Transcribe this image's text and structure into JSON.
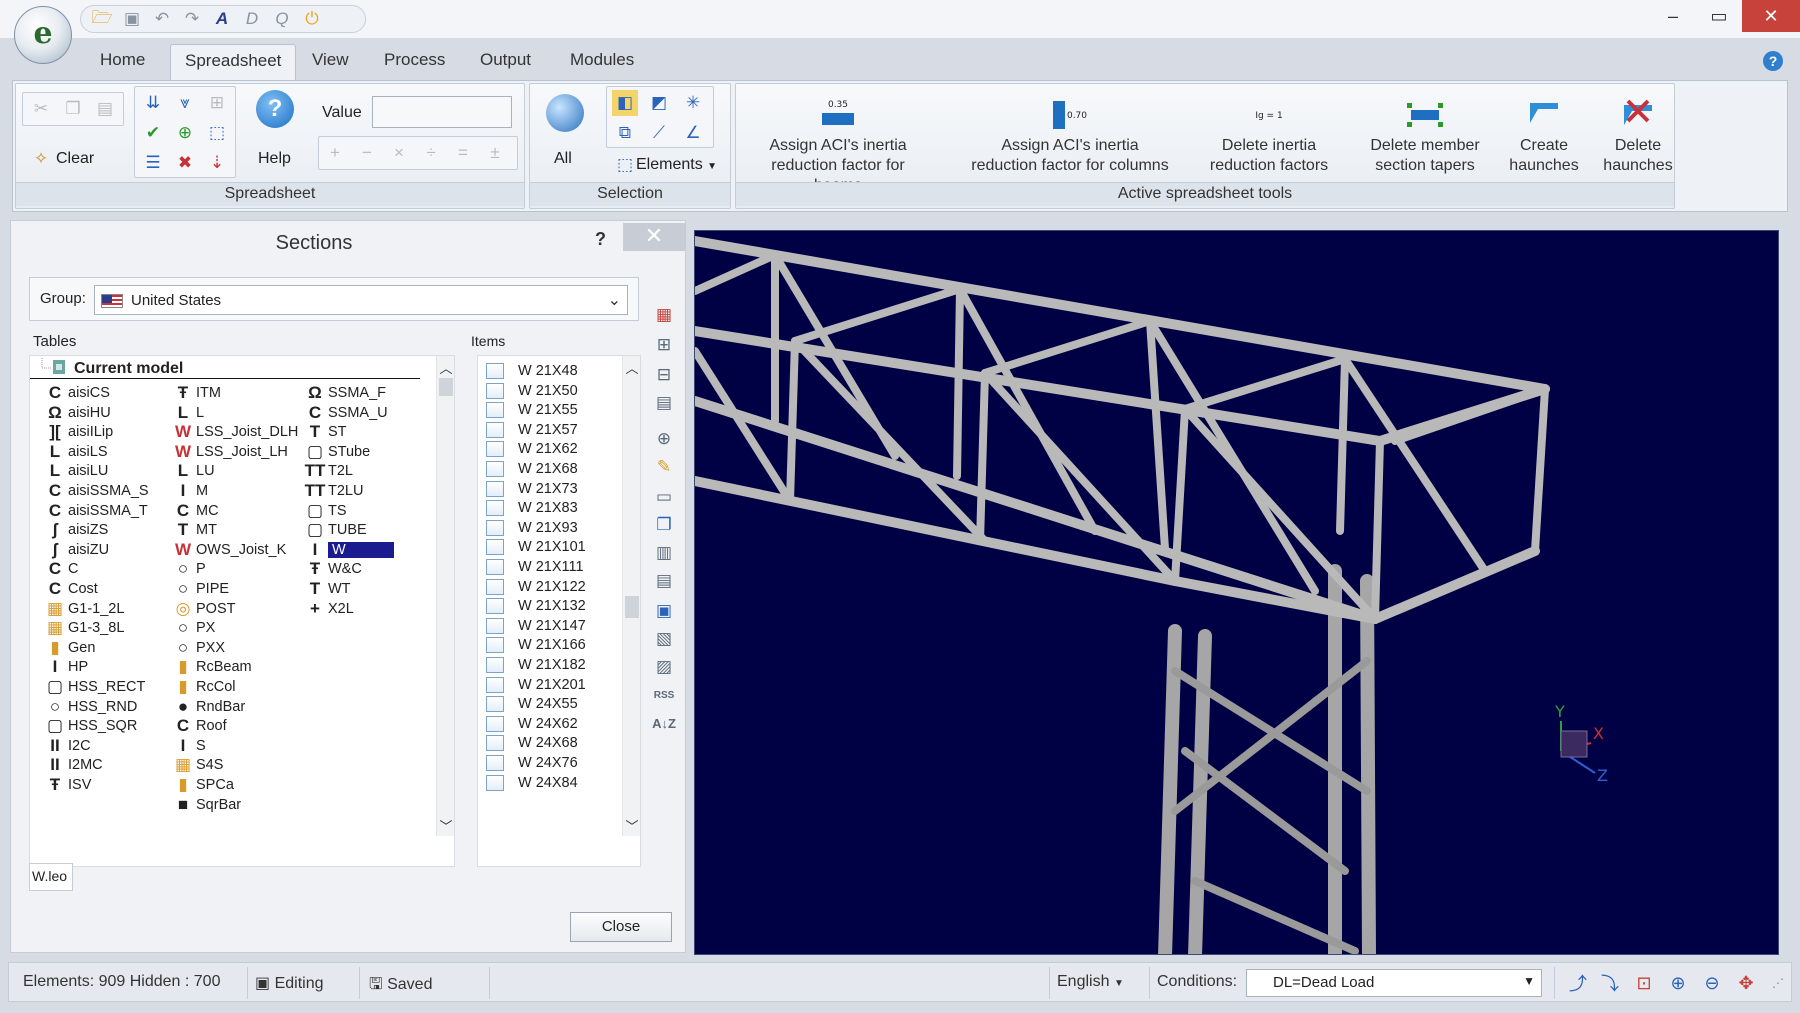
{
  "quick_access": {
    "icons": [
      "folder-open-icon",
      "save-icon",
      "undo-icon",
      "redo-icon",
      "font-icon",
      "text-icon",
      "search-icon",
      "power-icon"
    ]
  },
  "tabs": [
    {
      "label": "Home"
    },
    {
      "label": "Spreadsheet"
    },
    {
      "label": "View"
    },
    {
      "label": "Process"
    },
    {
      "label": "Output"
    },
    {
      "label": "Modules"
    }
  ],
  "ribbon": {
    "clear_label": "Clear",
    "help_label": "Help",
    "value_label": "Value",
    "value_input": "",
    "spreadsheet_group": "Spreadsheet",
    "all_label": "All",
    "elements_label": "Elements",
    "selection_group": "Selection",
    "active_group": "Active spreadsheet tools",
    "tools": [
      {
        "line1": "Assign ACI's inertia",
        "line2": "reduction factor for beams",
        "icon_text": "0.35"
      },
      {
        "line1": "Assign ACI's inertia",
        "line2": "reduction factor for columns",
        "icon_text": "0.70"
      },
      {
        "line1": "Delete inertia",
        "line2": "reduction factors",
        "icon_text": "Ig = 1"
      },
      {
        "line1": "Delete member",
        "line2": "section tapers",
        "icon_text": ""
      },
      {
        "line1": "Create",
        "line2": "haunches",
        "icon_text": ""
      },
      {
        "line1": "Delete",
        "line2": "haunches",
        "icon_text": ""
      }
    ]
  },
  "sections_panel": {
    "title": "Sections",
    "help": "?",
    "close_x": "✕",
    "group_label": "Group:",
    "group_value": "United States",
    "tables_label": "Tables",
    "items_label": "Items",
    "current_model": "Current model",
    "col1": [
      {
        "glyph": "C",
        "label": "aisiCS"
      },
      {
        "glyph": "Ω",
        "label": "aisiHU"
      },
      {
        "glyph": "][",
        "label": "aisiILip"
      },
      {
        "glyph": "L",
        "label": "aisiLS"
      },
      {
        "glyph": "L",
        "label": "aisiLU"
      },
      {
        "glyph": "C",
        "label": "aisiSSMA_S"
      },
      {
        "glyph": "C",
        "label": "aisiSSMA_T"
      },
      {
        "glyph": "ʃ",
        "label": "aisiZS"
      },
      {
        "glyph": "ʃ",
        "label": "aisiZU"
      },
      {
        "glyph": "C",
        "label": "C"
      },
      {
        "glyph": "C",
        "label": "Cost"
      },
      {
        "glyph": "▦",
        "label": "G1-1_2L"
      },
      {
        "glyph": "▦",
        "label": "G1-3_8L"
      },
      {
        "glyph": "▮",
        "label": "Gen"
      },
      {
        "glyph": "I",
        "label": "HP"
      },
      {
        "glyph": "▢",
        "label": "HSS_RECT"
      },
      {
        "glyph": "○",
        "label": "HSS_RND"
      },
      {
        "glyph": "▢",
        "label": "HSS_SQR"
      },
      {
        "glyph": "II",
        "label": "I2C"
      },
      {
        "glyph": "II",
        "label": "I2MC"
      },
      {
        "glyph": "Ŧ",
        "label": "ISV"
      }
    ],
    "col2": [
      {
        "glyph": "Ŧ",
        "label": "ITM"
      },
      {
        "glyph": "L",
        "label": "L"
      },
      {
        "glyph": "W",
        "label": "LSS_Joist_DLH"
      },
      {
        "glyph": "W",
        "label": "LSS_Joist_LH"
      },
      {
        "glyph": "L",
        "label": "LU"
      },
      {
        "glyph": "I",
        "label": "M"
      },
      {
        "glyph": "C",
        "label": "MC"
      },
      {
        "glyph": "T",
        "label": "MT"
      },
      {
        "glyph": "W",
        "label": "OWS_Joist_K"
      },
      {
        "glyph": "○",
        "label": "P"
      },
      {
        "glyph": "○",
        "label": "PIPE"
      },
      {
        "glyph": "◎",
        "label": "POST"
      },
      {
        "glyph": "○",
        "label": "PX"
      },
      {
        "glyph": "○",
        "label": "PXX"
      },
      {
        "glyph": "▮",
        "label": "RcBeam"
      },
      {
        "glyph": "▮",
        "label": "RcCol"
      },
      {
        "glyph": "●",
        "label": "RndBar"
      },
      {
        "glyph": "C",
        "label": "Roof"
      },
      {
        "glyph": "I",
        "label": "S"
      },
      {
        "glyph": "▦",
        "label": "S4S"
      },
      {
        "glyph": "▮",
        "label": "SPCa"
      },
      {
        "glyph": "■",
        "label": "SqrBar"
      }
    ],
    "col3": [
      {
        "glyph": "Ω",
        "label": "SSMA_F"
      },
      {
        "glyph": "C",
        "label": "SSMA_U"
      },
      {
        "glyph": "T",
        "label": "ST"
      },
      {
        "glyph": "▢",
        "label": "STube"
      },
      {
        "glyph": "TT",
        "label": "T2L"
      },
      {
        "glyph": "TT",
        "label": "T2LU"
      },
      {
        "glyph": "▢",
        "label": "TS"
      },
      {
        "glyph": "▢",
        "label": "TUBE"
      },
      {
        "glyph": "I",
        "label": "W",
        "selected": true
      },
      {
        "glyph": "Ŧ",
        "label": "W&C"
      },
      {
        "glyph": "T",
        "label": "WT"
      },
      {
        "glyph": "+",
        "label": "X2L"
      }
    ],
    "items": [
      "W 21X48",
      "W 21X50",
      "W 21X55",
      "W 21X57",
      "W 21X62",
      "W 21X68",
      "W 21X73",
      "W 21X83",
      "W 21X93",
      "W 21X101",
      "W 21X111",
      "W 21X122",
      "W 21X132",
      "W 21X147",
      "W 21X166",
      "W 21X182",
      "W 21X201",
      "W 24X55",
      "W 24X62",
      "W 24X68",
      "W 24X76",
      "W 24X84"
    ],
    "file_name": "W.leo",
    "close_button": "Close"
  },
  "viewport": {
    "axis_y": "Y",
    "axis_x": "X",
    "axis_z": "Z"
  },
  "status_bar": {
    "elements": "Elements: 909  Hidden : 700",
    "editing": "Editing",
    "saved": "Saved",
    "language": "English",
    "conditions_label": "Conditions:",
    "conditions_value": "DL=Dead Load"
  },
  "colors": {
    "viewport_bg": "#000045",
    "member": "#c8c8c8",
    "selected_row": "#1a1b8f",
    "accent": "#2f7fcf",
    "window_close": "#c7423a"
  }
}
